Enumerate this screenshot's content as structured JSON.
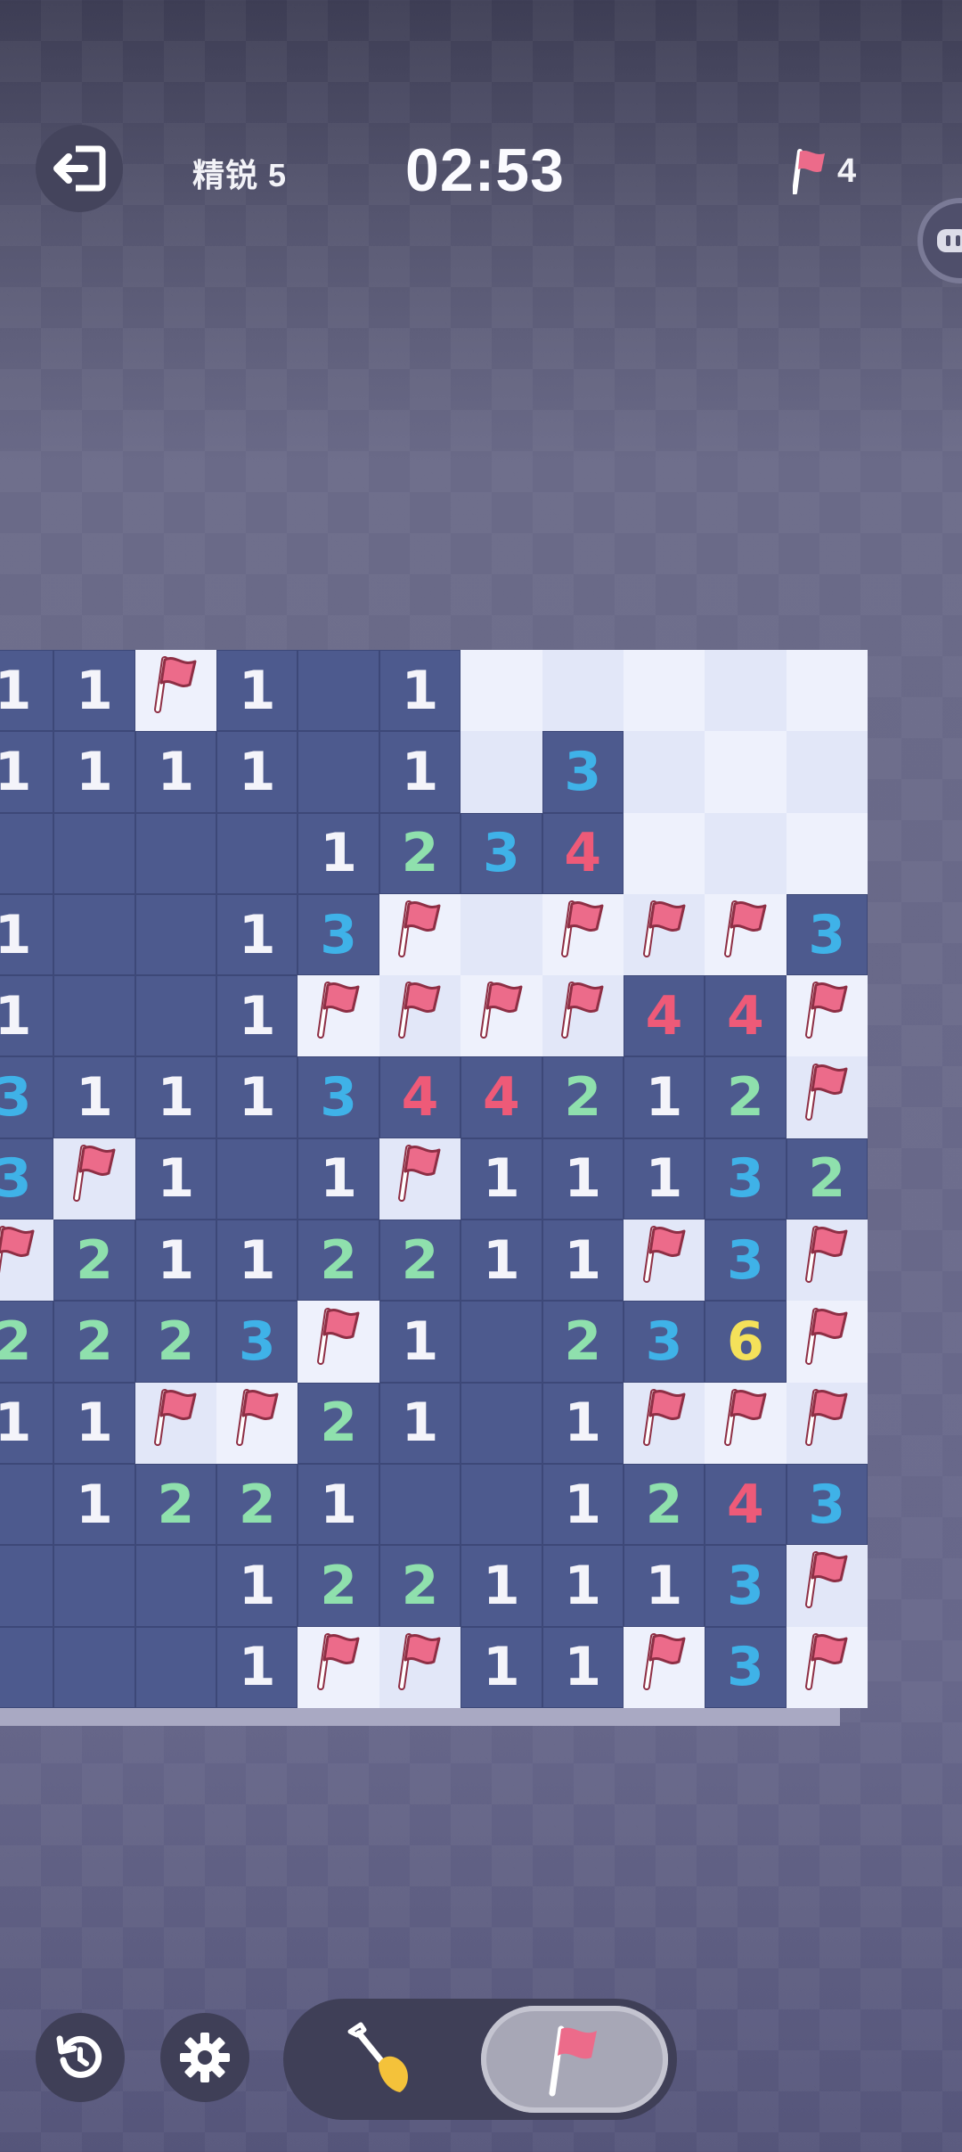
{
  "header": {
    "exit_icon": "exit-icon",
    "level_label": "精锐 5",
    "timer": "02:53",
    "flag_icon": "flag-icon",
    "flags_remaining": "4"
  },
  "side_bubble_icon": "chat-bubble-icon",
  "colors": {
    "open_cell": "#4d5a8e",
    "hidden_cell": "#eef1fc",
    "n1": "#f4f4fa",
    "n2": "#8fe0ad",
    "n3": "#3fb2e8",
    "n4": "#ee5a78",
    "n6": "#f4e15a",
    "flag": "#ec6b8a"
  },
  "board": {
    "rows": [
      [
        "1",
        "1",
        "F",
        "1",
        "",
        "1",
        "H",
        "H",
        "H",
        "H",
        "H"
      ],
      [
        "1",
        "1",
        "1",
        "1",
        "",
        "1",
        "H",
        "3",
        "H",
        "H",
        "H"
      ],
      [
        "",
        "",
        "",
        "",
        "1",
        "2",
        "3",
        "4",
        "H",
        "H",
        "H"
      ],
      [
        "1",
        "",
        "",
        "1",
        "3",
        "F",
        "H",
        "F",
        "F",
        "F",
        "3"
      ],
      [
        "1",
        "",
        "",
        "1",
        "F",
        "F",
        "F",
        "F",
        "4",
        "4",
        "F"
      ],
      [
        "3",
        "1",
        "1",
        "1",
        "3",
        "4",
        "4",
        "2",
        "1",
        "2",
        "F"
      ],
      [
        "3",
        "F",
        "1",
        "",
        "1",
        "F",
        "1",
        "1",
        "1",
        "3",
        "2"
      ],
      [
        "F",
        "2",
        "1",
        "1",
        "2",
        "2",
        "1",
        "1",
        "F",
        "3",
        "F"
      ],
      [
        "2",
        "2",
        "2",
        "3",
        "F",
        "1",
        "",
        "2",
        "3",
        "6",
        "F"
      ],
      [
        "1",
        "1",
        "F",
        "F",
        "2",
        "1",
        "",
        "1",
        "F",
        "F",
        "F"
      ],
      [
        "",
        "1",
        "2",
        "2",
        "1",
        "",
        "",
        "1",
        "2",
        "4",
        "3"
      ],
      [
        "",
        "",
        "",
        "1",
        "2",
        "2",
        "1",
        "1",
        "1",
        "3",
        "F"
      ],
      [
        "",
        "",
        "",
        "1",
        "F",
        "F",
        "1",
        "1",
        "F",
        "3",
        "F"
      ]
    ]
  },
  "bottom": {
    "restart_icon": "restart-icon",
    "settings_icon": "gear-icon",
    "dig_mode_icon": "shovel-icon",
    "flag_mode_icon": "flag-icon",
    "selected_mode": "flag"
  }
}
